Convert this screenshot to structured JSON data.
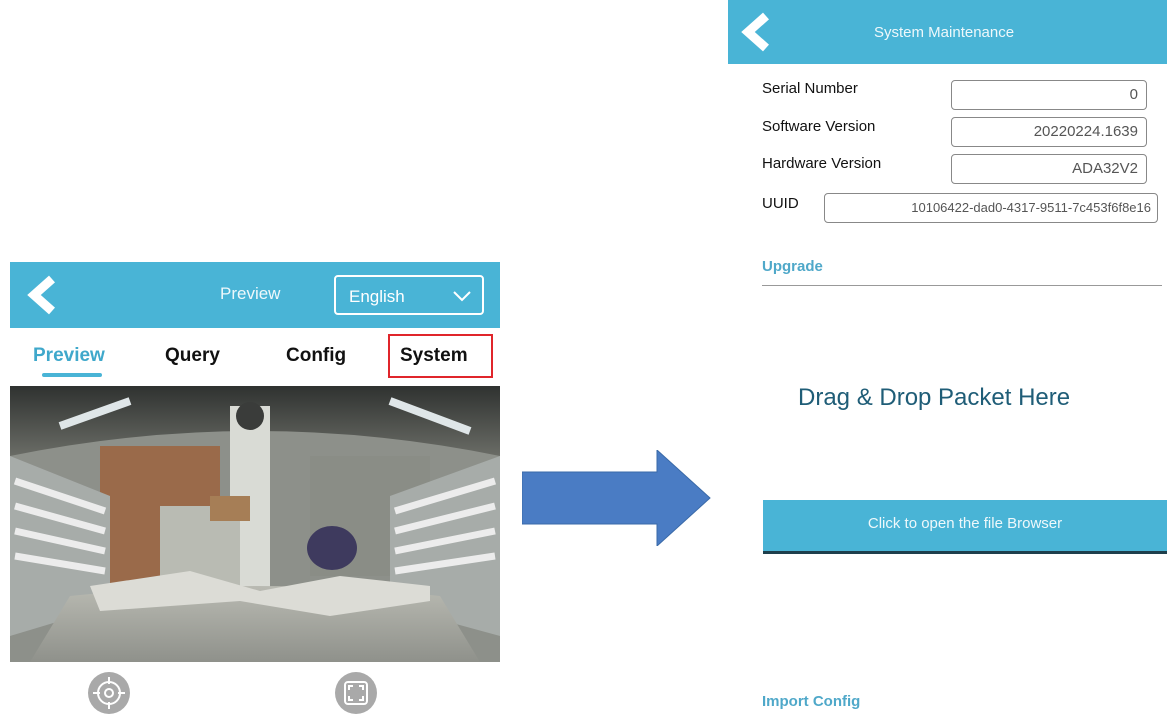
{
  "left_screen": {
    "header": {
      "title": "Preview",
      "language_select": {
        "value": "English"
      }
    },
    "tabs": [
      {
        "label": "Preview",
        "active": true
      },
      {
        "label": "Query",
        "active": false
      },
      {
        "label": "Config",
        "active": false
      },
      {
        "label": "System",
        "active": false,
        "highlighted": true
      }
    ],
    "controls": {
      "icons": [
        "crosshair-icon",
        "fullscreen-icon"
      ]
    },
    "colors": {
      "accent": "#49b4d6",
      "highlight": "#e0252b"
    }
  },
  "transition": {
    "icon": "right-arrow-icon",
    "color": "#4a7cc4"
  },
  "right_screen": {
    "header": {
      "title": "System Maintenance"
    },
    "info": [
      {
        "label": "Serial Number",
        "value": "0"
      },
      {
        "label": "Software Version",
        "value": "20220224.1639"
      },
      {
        "label": "Hardware Version",
        "value": "ADA32V2"
      },
      {
        "label": "UUID",
        "value": "10106422-dad0-4317-9511-7c453f6f8e16"
      }
    ],
    "upgrade": {
      "section_title": "Upgrade",
      "drop_text": "Drag & Drop Packet Here",
      "browse_button": "Click to open the file Browser"
    },
    "import_config": {
      "section_title": "Import Config"
    }
  }
}
